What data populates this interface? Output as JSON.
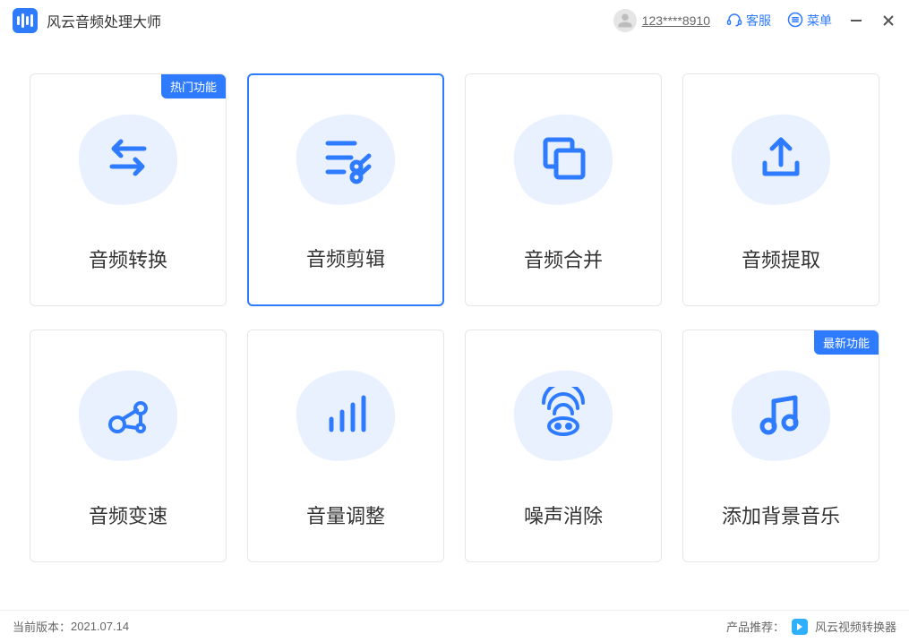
{
  "app": {
    "title": "风云音频处理大师"
  },
  "titlebar": {
    "username": "123****8910",
    "support": "客服",
    "menu": "菜单"
  },
  "badges": {
    "hot": "热门功能",
    "new": "最新功能"
  },
  "cards": [
    {
      "label": "音频转换"
    },
    {
      "label": "音频剪辑"
    },
    {
      "label": "音频合并"
    },
    {
      "label": "音频提取"
    },
    {
      "label": "音频变速"
    },
    {
      "label": "音量调整"
    },
    {
      "label": "噪声消除"
    },
    {
      "label": "添加背景音乐"
    }
  ],
  "footer": {
    "version_label": "当前版本：",
    "version_value": "2021.07.14",
    "recommend_label": "产品推荐：",
    "recommend_name": "风云视频转换器"
  }
}
